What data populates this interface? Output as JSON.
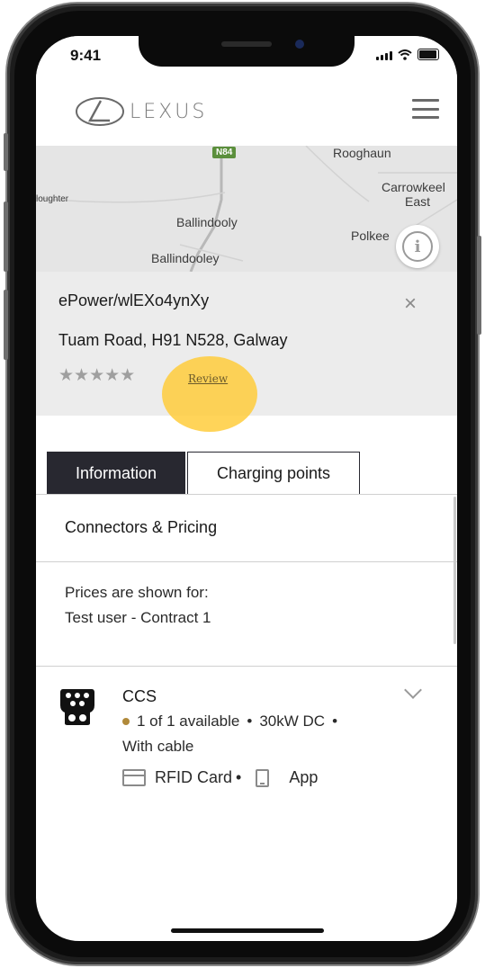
{
  "status_bar": {
    "time": "9:41"
  },
  "header": {
    "brand": "LEXUS"
  },
  "map": {
    "road_badge": "N84",
    "places": [
      "Rooghaun",
      "Carrowkeel",
      "East",
      "loughter",
      "Ballindooly",
      "Polkee",
      "Ballindooley"
    ]
  },
  "station": {
    "name": "ePower/wlEXo4ynXy",
    "address": "Tuam Road, H91 N528, Galway",
    "stars": "★★★★★",
    "review_label": "Review",
    "close_glyph": "×"
  },
  "tabs": [
    {
      "label": "Information",
      "active": true
    },
    {
      "label": "Charging points",
      "active": false
    }
  ],
  "section": {
    "title": "Connectors & Pricing",
    "prices_label": "Prices are shown for:",
    "prices_user": "Test user - Contract 1"
  },
  "connector": {
    "type": "CCS",
    "availability": "1 of 1 available",
    "sep1": "•",
    "power": "30kW DC",
    "sep2": "•",
    "cable": "With cable",
    "payment_rfid": "RFID Card",
    "payment_sep": "•",
    "payment_app": "App"
  },
  "colors": {
    "tab_active_bg": "#282830",
    "highlight": "#ffcd3c",
    "availability_dot": "#b0893a"
  }
}
